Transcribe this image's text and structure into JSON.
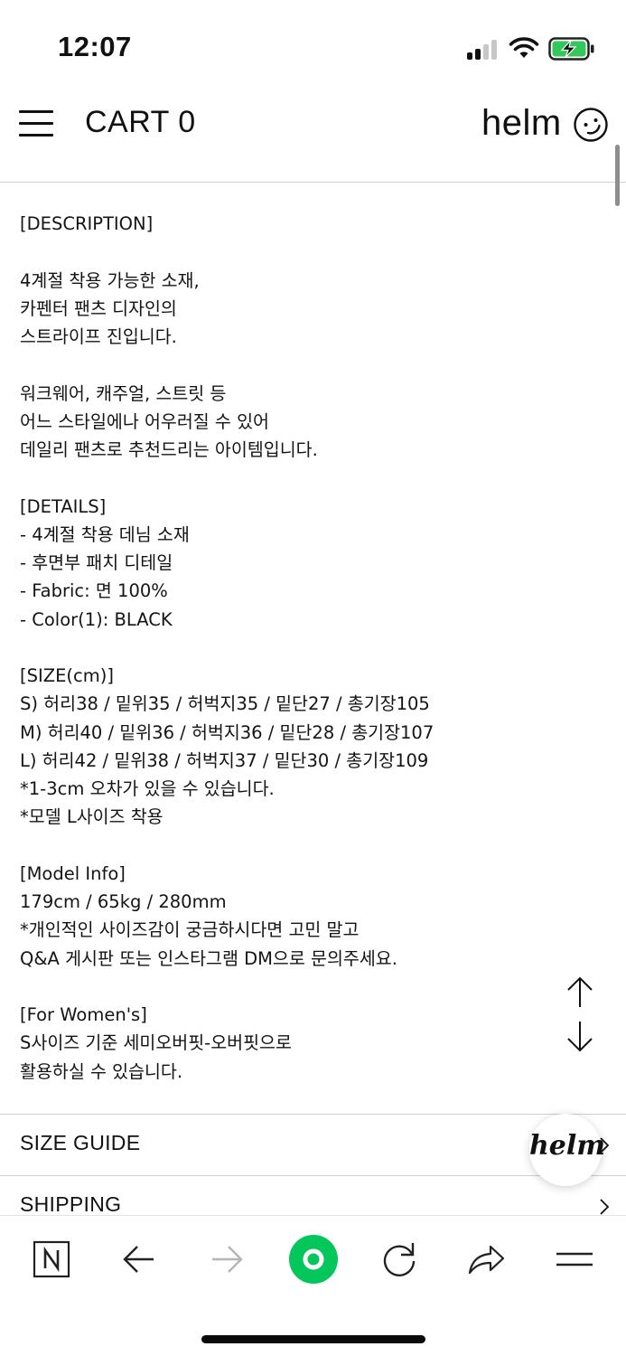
{
  "status_bar": {
    "time": "12:07",
    "icons": [
      "cellular-signal-icon",
      "wifi-icon",
      "battery-charging-icon"
    ],
    "battery_color": "#34c759"
  },
  "header": {
    "menu_icon": "hamburger-menu-icon",
    "cart_label": "CART 0",
    "brand": "helm",
    "brand_icon": "smiley-face-icon"
  },
  "description_lines": [
    "[DESCRIPTION]",
    "",
    "4계절 착용 가능한 소재,",
    "카펜터 팬츠 디자인의",
    "스트라이프 진입니다.",
    "",
    "워크웨어, 캐주얼, 스트릿 등",
    "어느 스타일에나 어우러질 수 있어",
    "데일리 팬츠로 추천드리는 아이템입니다.",
    "",
    "[DETAILS]",
    "- 4계절 착용 데님 소재",
    "- 후면부 패치 디테일",
    "- Fabric: 면 100%",
    "- Color(1): BLACK",
    "",
    "[SIZE(cm)]",
    "S) 허리38 / 밑위35 / 허벅지35 / 밑단27 / 총기장105",
    "M) 허리40 / 밑위36 / 허벅지36 / 밑단28 / 총기장107",
    "L) 허리42 / 밑위38 / 허벅지37 / 밑단30 / 총기장109",
    "*1-3cm 오차가 있을 수 있습니다.",
    "*모델 L사이즈 착용",
    "",
    "[Model Info]",
    "179cm / 65kg / 280mm",
    "*개인적인 사이즈감이 궁금하시다면 고민 말고",
    "Q&A 게시판 또는 인스타그램 DM으로 문의주세요.",
    "",
    "[For Women's]",
    "S사이즈 기준 세미오버핏-오버핏으로",
    "활용하실 수 있습니다."
  ],
  "scroll_controls": {
    "up_icon": "scroll-up-arrow-icon",
    "down_icon": "scroll-down-arrow-icon"
  },
  "accordion": [
    {
      "label": "SIZE GUIDE"
    },
    {
      "label": "SHIPPING"
    }
  ],
  "floating_badge": {
    "text": "helm"
  },
  "browser_toolbar": {
    "items": [
      "naver-n-icon",
      "back-arrow-icon",
      "forward-arrow-icon",
      "green-home-icon",
      "reload-icon",
      "share-icon",
      "menu-lines-icon"
    ],
    "accent_color": "#03c75a"
  }
}
